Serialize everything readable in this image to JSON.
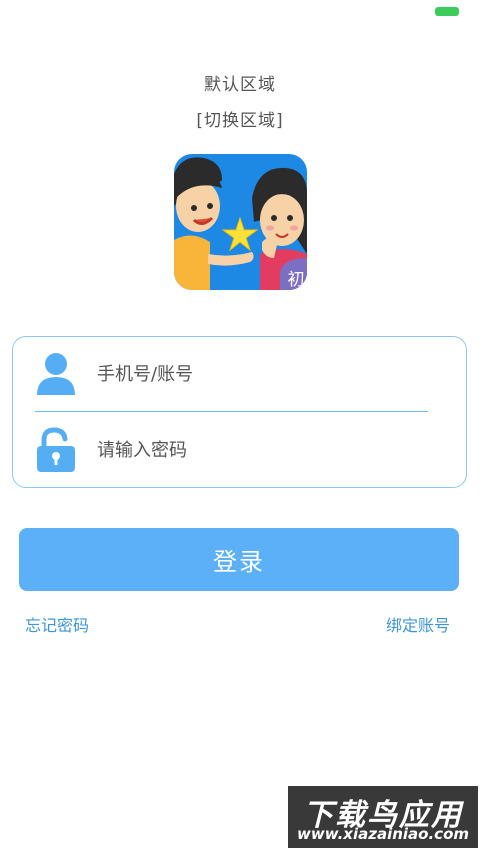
{
  "status_bar": {
    "battery_color": "#3ccc5b"
  },
  "region": {
    "current_label": "默认区域",
    "switch_label": "[切换区域]"
  },
  "logo": {
    "badge_text": "初",
    "background_color": "#1e88e5"
  },
  "form": {
    "account": {
      "placeholder": "手机号/账号",
      "value": "",
      "icon": "user-icon"
    },
    "password": {
      "placeholder": "请输入密码",
      "value": "",
      "icon": "unlock-icon"
    },
    "border_color": "#8fc6ef"
  },
  "actions": {
    "login_label": "登录",
    "forgot_label": "忘记密码",
    "bind_label": "绑定账号",
    "accent_color": "#5bb0f8",
    "link_color": "#3f96d6"
  },
  "watermark": {
    "title": "下载鸟应用",
    "url": "www.xiazainiao.com"
  }
}
